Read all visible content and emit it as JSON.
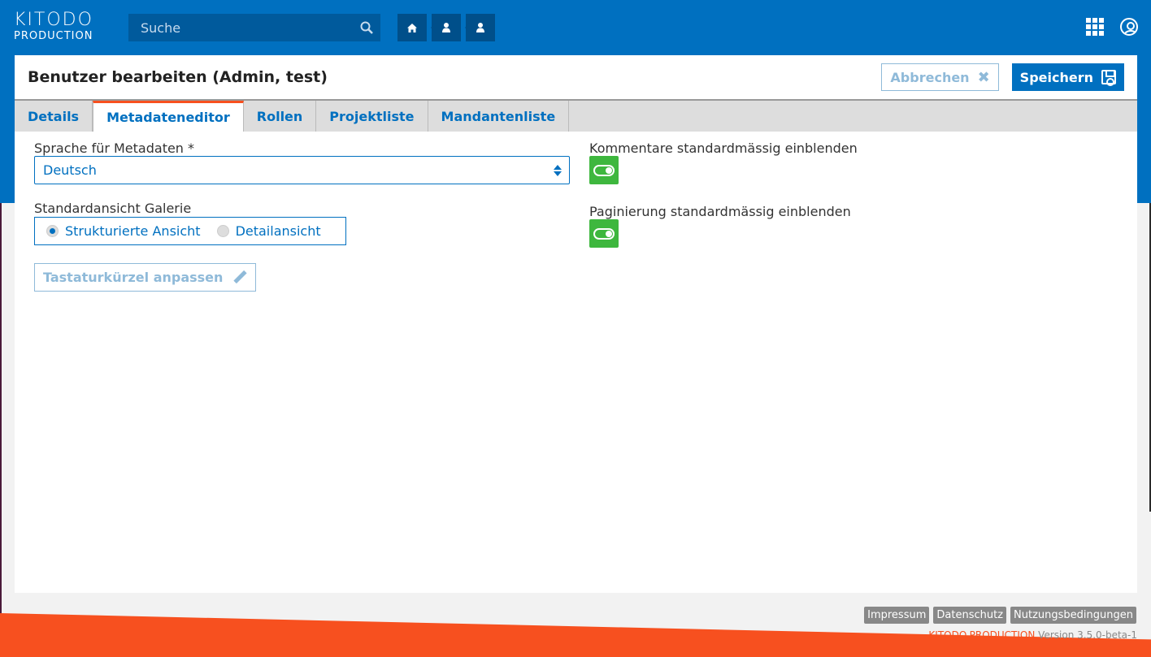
{
  "header": {
    "logo_line1": "KITODO",
    "logo_line2": "PRODUCTION",
    "search_placeholder": "Suche",
    "breadcrumbs": [
      "home-icon",
      "user-icon",
      "user-icon"
    ]
  },
  "panel": {
    "title": "Benutzer bearbeiten (Admin, test)",
    "cancel_label": "Abbrechen",
    "save_label": "Speichern"
  },
  "tabs": [
    {
      "label": "Details",
      "active": false
    },
    {
      "label": "Metadateneditor",
      "active": true
    },
    {
      "label": "Rollen",
      "active": false
    },
    {
      "label": "Projektliste",
      "active": false
    },
    {
      "label": "Mandantenliste",
      "active": false
    }
  ],
  "form": {
    "language_label": "Sprache für Metadaten *",
    "language_value": "Deutsch",
    "gallery_label": "Standardansicht Galerie",
    "gallery_options": [
      {
        "label": "Strukturierte Ansicht",
        "checked": true
      },
      {
        "label": "Detailansicht",
        "checked": false
      }
    ],
    "shortcut_button": "Tastaturkürzel anpassen",
    "comments_label": "Kommentare standardmässig einblenden",
    "comments_enabled": true,
    "pagination_label": "Paginierung standardmässig einblenden",
    "pagination_enabled": true
  },
  "footer": {
    "links": [
      "Impressum",
      "Datenschutz",
      "Nutzungsbedingungen"
    ],
    "brand": "KITODO.PRODUCTION",
    "version": "Version 3.5.0-beta-1"
  },
  "colors": {
    "primary": "#0070c0",
    "accent": "#f7501f",
    "toggle_on": "#3eb73e"
  }
}
